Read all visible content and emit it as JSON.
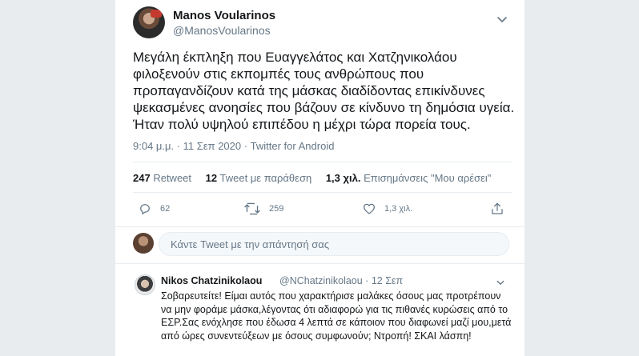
{
  "tweet": {
    "author_name": "Manos Voularinos",
    "author_handle": "@ManosVoularinos",
    "text": "Μεγάλη έκπληξη που Ευαγγελάτος και Χατζηνικολάου φιλοξενούν στις εκπομπές τους ανθρώπους που προπαγανδίζουν κατά της μάσκας διαδίδοντας επικίνδυνες ψεκασμένες ανοησίες που βάζουν σε κίνδυνο τη δημόσια υγεία. Ήταν πολύ υψηλού επιπέδου η μέχρι τώρα πορεία τους.",
    "meta": "9:04 μ.μ. · 11 Σεπ 2020 · Twitter for Android",
    "stats": {
      "retweets_count": "247",
      "retweets_label": "Retweet",
      "quotes_count": "12",
      "quotes_label": "Tweet με παράθεση",
      "likes_count": "1,3 χιλ.",
      "likes_label": "Επισημάνσεις \"Μου αρέσει\""
    },
    "actions": {
      "reply_count": "62",
      "retweet_count": "259",
      "like_count": "1,3 χιλ."
    },
    "icons": [
      "chevron-down-icon",
      "reply-icon",
      "retweet-icon",
      "like-icon",
      "share-icon"
    ]
  },
  "reply_box": {
    "placeholder": "Κάντε Tweet με την απάντησή σας"
  },
  "reply": {
    "author_name": "Nikos Chatzinikolaou",
    "author_handle_date": "@NChatzinikolaou · 12 Σεπ",
    "text": "Σοβαρευτείτε! Είμαι αυτός που χαρακτήρισε μαλάκες όσους μας προτρέπουν να μην φοράμε μάσκα,λέγοντας ότι αδιαφορώ για τις πιθανές κυρώσεις από το ΕΣΡ.Σας ενόχλησε που έδωσα 4 λεπτά σε κάποιον που διαφωνεί μαζί μου,μετά από ώρες συνεντεύξεων με όσους συμφωνούν; Ντροπή! ΣΚΑΙ λάσπη!"
  },
  "colors": {
    "page_bg": "#e9ecee",
    "card_bg": "#ffffff",
    "text": "#14171a",
    "muted": "#657786",
    "divider": "#e6ecf0"
  }
}
